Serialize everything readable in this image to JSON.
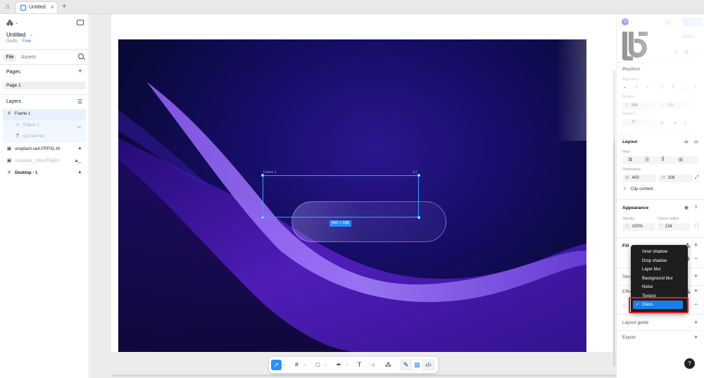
{
  "browser": {
    "tab_title": "Untitled"
  },
  "left_panel": {
    "file_name": "Untitled",
    "drafts": "Drafts",
    "plan": "Free",
    "tabs": [
      "File",
      "Assets"
    ],
    "pages_title": "Pages",
    "pages": [
      "Page 1"
    ],
    "layers_title": "Layers",
    "layers": [
      {
        "name": "Frame 1",
        "icon": "frame-icon",
        "state": "selected"
      },
      {
        "name": "Ellipse 1",
        "icon": "ellipse-icon",
        "state": "dim"
      },
      {
        "name": "Get blurred",
        "icon": "text-icon",
        "state": "dim"
      },
      {
        "name": "unsplash:seA-FPPXL-M",
        "icon": "image-icon",
        "state": "normal"
      },
      {
        "name": "unsplash:_n9ze7F0gRo",
        "icon": "image-icon",
        "state": "dim"
      },
      {
        "name": "Desktop - 1",
        "icon": "frame-icon",
        "state": "normal"
      }
    ]
  },
  "canvas": {
    "selection_size": "400 × 108",
    "selection_name": "Frame 1",
    "selection_corner": "1/1"
  },
  "right_panel": {
    "avatar_initial": "G",
    "share_label": "Share",
    "zoom": "106%",
    "position_title": "Position",
    "alignment_label": "Alignment",
    "position_label": "Position",
    "x_label": "X",
    "x_value": "386",
    "y_label": "Y",
    "y_value": "581",
    "rotation_label": "Rotation",
    "rotation_value": "0°",
    "layout_title": "Layout",
    "flow_label": "Flow",
    "dimensions_label": "Dimensions",
    "w_label": "W",
    "w_value": "400",
    "h_label": "H",
    "h_value": "108",
    "clip_content": "Clip content",
    "appearance_title": "Appearance",
    "opacity_label": "Opacity",
    "opacity_value": "100%",
    "corner_radius_label": "Corner radius",
    "corner_radius_value": "134",
    "fill_title": "Fill",
    "stroke_title": "Strok",
    "effects_title": "Effe",
    "layout_guide_title": "Layout guide",
    "export_title": "Export",
    "help": "?"
  },
  "effects_dropdown": {
    "items": [
      "Inner shadow",
      "Drop shadow",
      "Layer blur",
      "Background blur",
      "Noise",
      "Texture"
    ],
    "selected": "Glass"
  },
  "colors": {
    "accent": "#2a8fff",
    "highlight": "#e02020",
    "dropdown_bg": "#1e1e1e"
  }
}
